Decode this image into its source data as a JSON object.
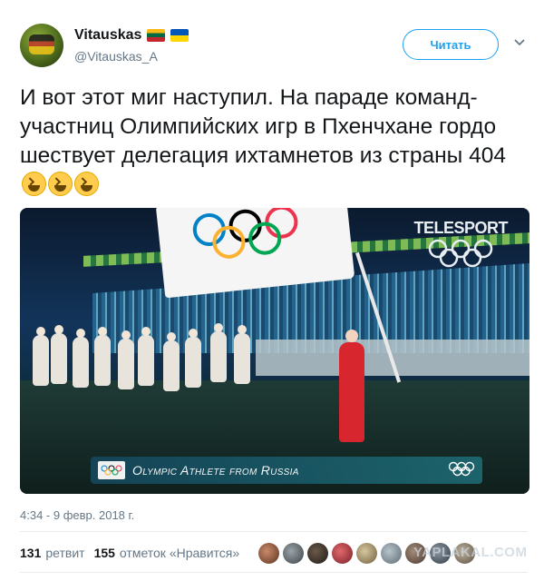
{
  "user": {
    "display_name": "Vitauskas",
    "handle": "@Vitauskas_A",
    "flags": [
      "lithuania-flag",
      "ukraine-flag"
    ]
  },
  "follow_button": {
    "label": "Читать"
  },
  "menu": {
    "icon": "chevron-down-icon"
  },
  "tweet": {
    "text": "И вот этот миг наступил. На параде команд-участниц Олимпийских игр в Пхенчхане гордо шествует делегация ихтамнетов из страны 404",
    "emoji": [
      "grinning-squinting-face",
      "grinning-squinting-face",
      "grinning-squinting-face"
    ]
  },
  "media": {
    "channel_logo": "TELESPORT",
    "lower_third": "Olympic Athlete from Russia"
  },
  "timestamp": "4:34 - 9 февр. 2018 г.",
  "stats": {
    "retweets_count": "131",
    "retweets_label": "ретвит",
    "likes_count": "155",
    "likes_label": "отметок «Нравится»"
  },
  "watermark": "YAPLAKAL.COM",
  "colors": {
    "accent": "#1da1f2",
    "text": "#14171a",
    "muted": "#657786",
    "divider": "#e6ecf0"
  }
}
